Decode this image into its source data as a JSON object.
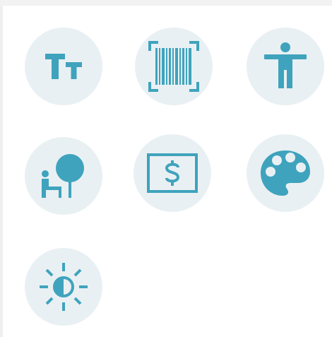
{
  "colors": {
    "accent": "#3fa3bd",
    "circle_background": "#e9f0f3",
    "page_background": "#ffffff"
  },
  "icons": [
    {
      "name": "text-size-icon"
    },
    {
      "name": "barcode-scan-icon"
    },
    {
      "name": "accessibility-icon"
    },
    {
      "name": "person-tree-icon"
    },
    {
      "name": "dollar-bill-icon"
    },
    {
      "name": "palette-icon"
    },
    {
      "name": "brightness-contrast-icon"
    }
  ]
}
